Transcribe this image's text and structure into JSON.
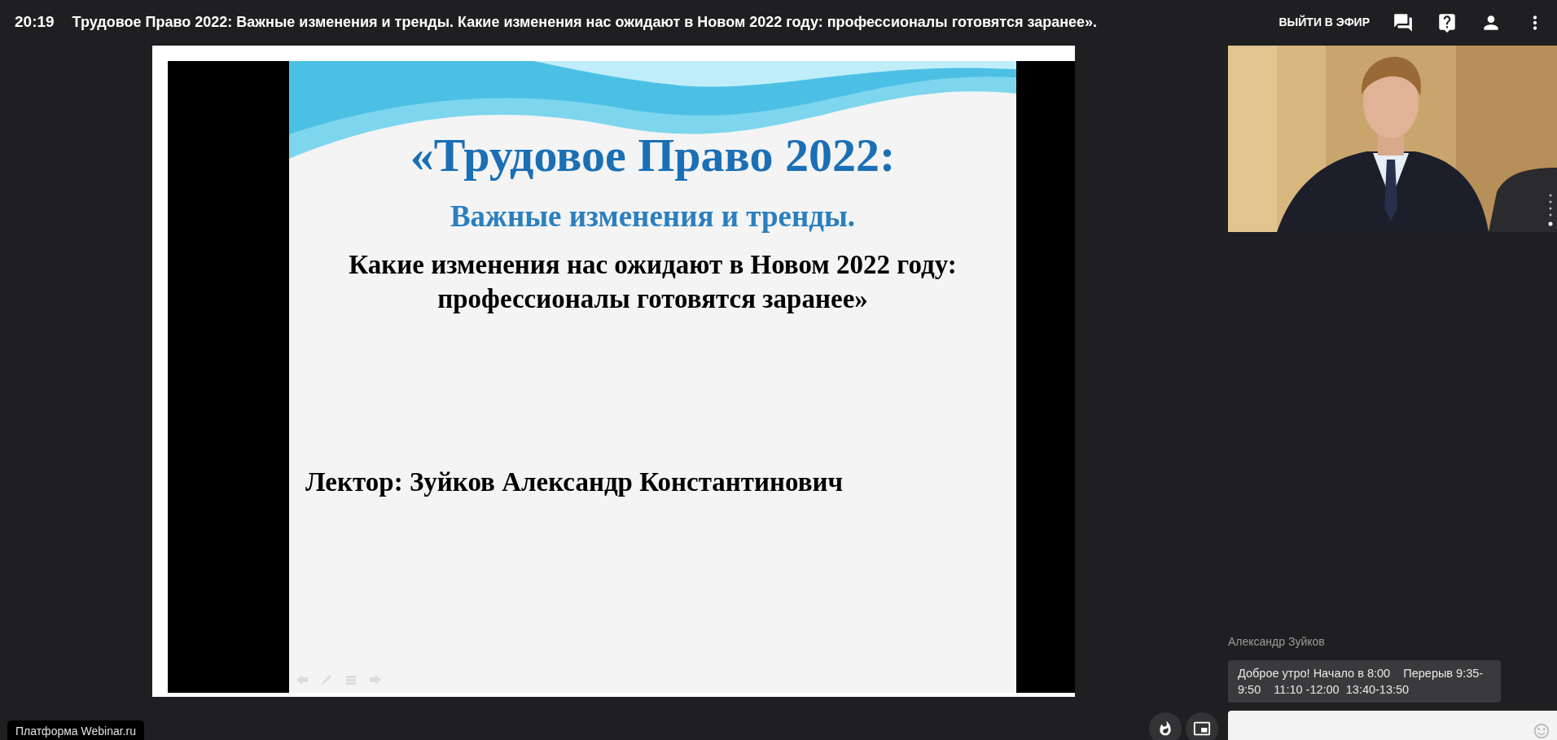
{
  "top_bar": {
    "time": "20:19",
    "title": "Трудовое Право 2022: Важные изменения и тренды. Какие изменения нас ожидают в Новом 2022 году: профессионалы готовятся заранее».",
    "go_live_button": "ВЫЙТИ В ЭФИР"
  },
  "slide": {
    "title": "«Трудовое Право 2022:",
    "subtitle": "Важные изменения и тренды.",
    "lines": [
      "Какие изменения нас ожидают в Новом 2022 году:",
      "профессионалы готовятся заранее»"
    ],
    "lecturer": "Лектор: Зуйков Александр Константинович"
  },
  "platform_badge": "Платформа Webinar.ru",
  "chat": {
    "messages": [
      {
        "author": "Александр Зуйков",
        "text": "Доброе утро! Начало в 8:00    Перерыв 9:35-9:50    11:10 -12:00  13:40-13:50"
      }
    ]
  }
}
